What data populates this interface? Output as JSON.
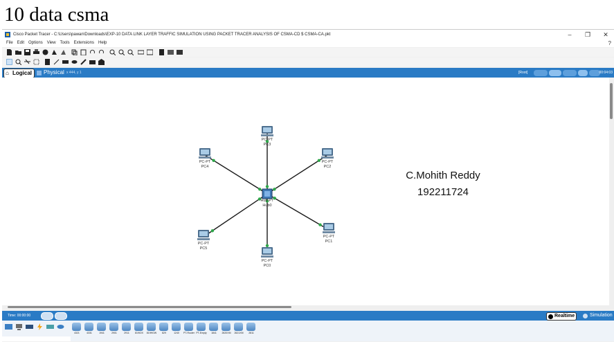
{
  "doc_title": "10 data csma",
  "window": {
    "title": "Cisco Packet Tracer - C:\\Users\\pawan\\Downloads\\EXP-10 DATA LINK LAYER TRAFFIC SIMULATION USING PACKET TRACER ANALYSIS OF CSMA-CD $ CSMA-CA.pkt",
    "minimize": "–",
    "maximize": "❐",
    "close": "✕"
  },
  "menu": [
    "File",
    "Edit",
    "Options",
    "View",
    "Tools",
    "Extensions",
    "Help"
  ],
  "help_glyph": "?",
  "modebar": {
    "logical": "Logical",
    "physical": "Physical",
    "coord": "x 444, y 1",
    "root": "[Root]",
    "time": "00:04:03"
  },
  "network": {
    "hub_type": "Hub-PT",
    "hub_name": "Hub0",
    "pc_type": "PC-PT",
    "pcs": [
      "PC0",
      "PC1",
      "PC2",
      "PC3",
      "PC4",
      "PC5"
    ]
  },
  "annotation": {
    "name": "C.Mohith Reddy",
    "id": "192211724"
  },
  "bottom": {
    "time": "Time: 00:00:00",
    "realtime": "Realtime",
    "simulation": "Simulation"
  },
  "device_models": [
    "4321",
    "4331",
    "1941",
    "2901",
    "2911",
    "819IOX",
    "819HGW",
    "829",
    "1240",
    "PT-Router",
    "PT-Empty",
    "1841",
    "2620XM",
    "2621XM",
    "2811"
  ],
  "colors": {
    "accent_blue": "#2a7bc5",
    "link_green": "#2fa84a"
  }
}
